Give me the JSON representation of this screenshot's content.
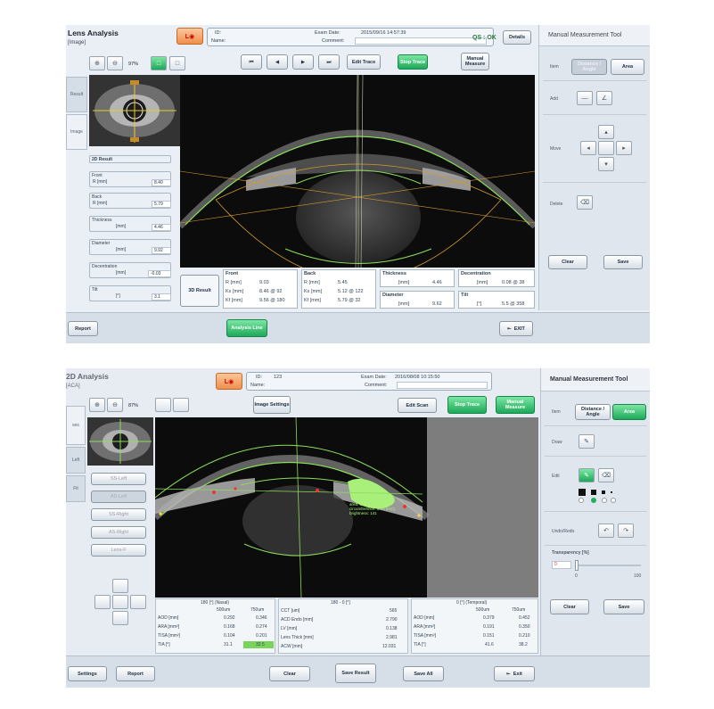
{
  "top": {
    "title": "Lens Analysis",
    "subtitle": "[Image]",
    "id_label": "ID:",
    "name_label": "Name:",
    "exam_date_label": "Exam Date:",
    "exam_date_value": "2015/09/16 14:57:39",
    "comment_label": "Comment:",
    "qs_label": "QS : OK",
    "details_button": "Details",
    "zoom_value": "97%",
    "edit_trace_button": "Edit Trace",
    "stop_trace_button": "Stop Trace",
    "manual_measure_button": "Manual Measure",
    "side_tab_1": "Result",
    "side_tab_2": "Image",
    "report_button": "Report",
    "analysis_line_button": "Analysis Line",
    "exit_button": "EXIT",
    "left_results": {
      "header": "2D Result",
      "front_label": "Front",
      "front_unit": "R    [mm]",
      "front_value": "8.40",
      "back_label": "Back",
      "back_unit": "R    [mm]",
      "back_value": "5.79",
      "thickness_label": "Thickness",
      "thickness_unit": "[mm]",
      "thickness_value": "4.46",
      "diameter_label": "Diameter",
      "diameter_unit": "[mm]",
      "diameter_value": "9.92",
      "decentration_label": "Decentration",
      "decentration_unit": "[mm]",
      "decentration_value": "-0.03",
      "tilt_label": "Tilt",
      "tilt_unit": "[°]",
      "tilt_value": "3.1"
    },
    "result_3d": {
      "label": "3D Result",
      "front_header": "Front",
      "front_rows": [
        {
          "k": "R    [mm]",
          "v": "9.03"
        },
        {
          "k": "Ks   [mm]",
          "v": "8.46 @ 92"
        },
        {
          "k": "Kf   [mm]",
          "v": "9.56 @ 180"
        }
      ],
      "back_header": "Back",
      "back_rows": [
        {
          "k": "R    [mm]",
          "v": "5.45"
        },
        {
          "k": "Ks   [mm]",
          "v": "5.12 @ 122"
        },
        {
          "k": "Kf   [mm]",
          "v": "5.79 @ 32"
        }
      ],
      "thickness_header": "Thickness",
      "thickness_unit": "[mm]",
      "thickness_value": "4.46",
      "diameter_header": "Diameter",
      "diameter_unit": "[mm]",
      "diameter_value": "9.62",
      "decentration_header": "Decentration",
      "decentration_unit": "[mm]",
      "decentration_value": "0.08 @ 38",
      "tilt_header": "Tilt",
      "tilt_unit": "[°]",
      "tilt_value": "5.5 @ 358"
    },
    "panel": {
      "title": "Manual Measurement Tool",
      "item_label": "Item",
      "item_opt1": "Distance / Angle",
      "item_opt2": "Area",
      "add_label": "Add",
      "move_label": "Move",
      "delete_label": "Delete",
      "clear_button": "Clear",
      "save_button": "Save"
    }
  },
  "bottom": {
    "title": "2D Analysis",
    "subtitle": "[ACA]",
    "id_label": "ID:",
    "id_value": "123",
    "name_label": "Name:",
    "exam_date_label": "Exam Date:",
    "exam_date_value": "2016/08/08 10:15:50",
    "comment_label": "Comment:",
    "zoom_value": "87%",
    "image_settings_button": "Image Settings",
    "edit_scan_button": "Edit Scan",
    "stop_trace_button": "Stop Trace",
    "manual_measure_button": "Manual Measure",
    "side_tab_1": "ses",
    "side_tab_2": "Left",
    "side_tab_3": "Fit",
    "scan_list": [
      "SS-Left",
      "AS-Left",
      "SS-Right",
      "AS-Right",
      "Lens-F"
    ],
    "overlay_line1": "area: 1.05 [mm²]",
    "overlay_line2": "circumference: 5.03 [mm]",
    "overlay_line3": "brightness: 141",
    "nasal": {
      "header": "180 [°] (Nasal)",
      "col1": "500um",
      "col2": "750um",
      "rows": [
        {
          "k": "AOD [mm]",
          "v1": "0.292",
          "v2": "0.346"
        },
        {
          "k": "ARA [mm²]",
          "v1": "0.168",
          "v2": "0.274"
        },
        {
          "k": "TISA [mm²]",
          "v1": "0.104",
          "v2": "0.201"
        },
        {
          "k": "TIA [°]",
          "v1": "31.1",
          "v2": "32.5"
        }
      ]
    },
    "center": {
      "header": "180 - 0 [°]",
      "rows": [
        {
          "k": "CCT [um]",
          "v": "565"
        },
        {
          "k": "ACD Endo [mm]",
          "v": "2.790"
        },
        {
          "k": "LV [mm]",
          "v": "0.138"
        },
        {
          "k": "Lens Thick [mm]",
          "v": "2.981"
        },
        {
          "k": "ACW [mm]",
          "v": "12.031"
        }
      ]
    },
    "temporal": {
      "header": "0 [°] (Temporal)",
      "col1": "500um",
      "col2": "750um",
      "rows": [
        {
          "k": "AOD [mm]",
          "v1": "0.379",
          "v2": "0.452"
        },
        {
          "k": "ARA [mm²]",
          "v1": "0.191",
          "v2": "0.350"
        },
        {
          "k": "TISA [mm²]",
          "v1": "0.151",
          "v2": "0.210"
        },
        {
          "k": "TIA [°]",
          "v1": "41.6",
          "v2": "38.2"
        }
      ]
    },
    "settings_button": "Settings",
    "report_button": "Report",
    "clear_button": "Clear",
    "save_result_button": "Save Result",
    "save_all_button": "Save All",
    "exit_button": "Exit",
    "panel": {
      "title": "Manual Measurement Tool",
      "item_label": "Item",
      "item_opt1": "Distance / Angle",
      "item_opt2": "Area",
      "draw_label": "Draw",
      "edit_label": "Edit",
      "undo_label": "Undo/Redo",
      "transparency_label": "Transparency [%]",
      "transparency_value": "0",
      "slider_min": "0",
      "slider_max": "100",
      "clear_button": "Clear",
      "save_button": "Save"
    }
  },
  "colors": {
    "trace_green": "#8bdc5a",
    "button_green": "#22b05f",
    "measure_green": "#a8f07a",
    "guide_orange": "#d49a2c",
    "logo_orange": "#ef8f4c"
  }
}
